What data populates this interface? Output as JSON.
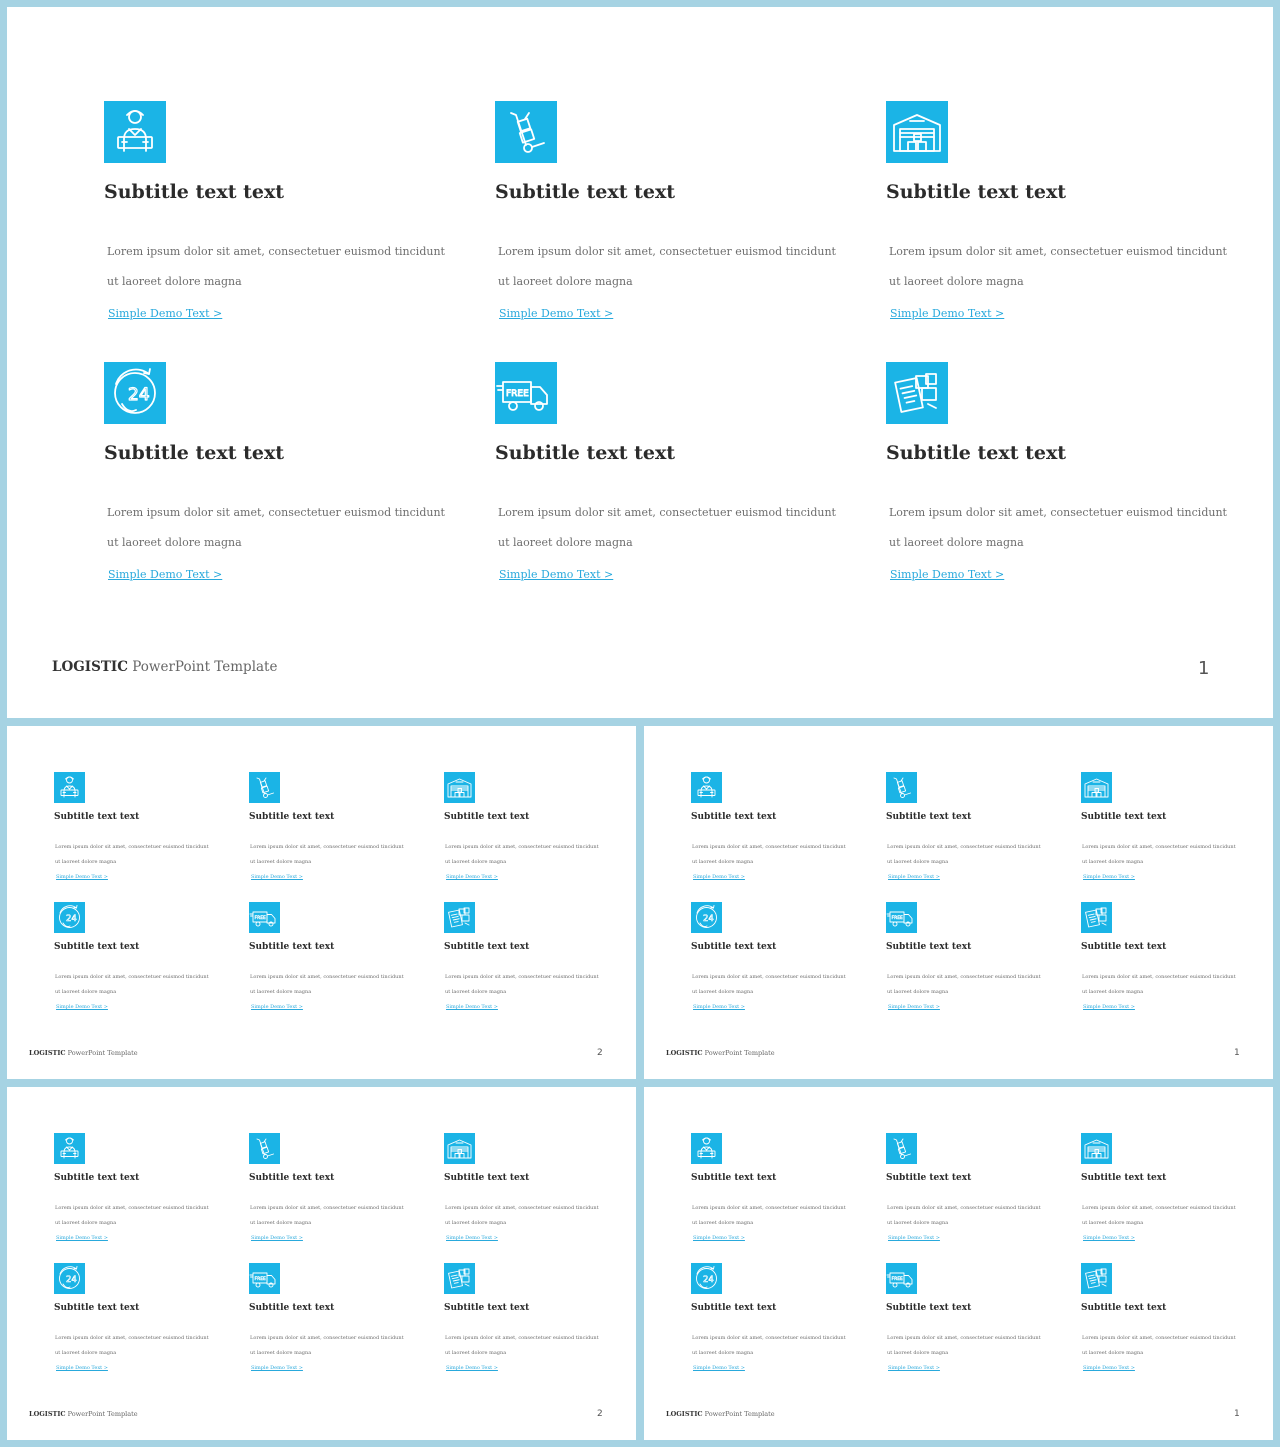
{
  "colors": {
    "accent": "#1bb4e6",
    "link": "#29a9dc",
    "frame": "#a6d3e3"
  },
  "cards": [
    {
      "icon": "delivery-man-icon",
      "subtitle": "Subtitle text text",
      "body_line1": "Lorem  ipsum  dolor  sit  amet,  consectetuer  euismod  tincidunt",
      "body_line2": "ut  laoreet  dolore  magna",
      "link": "Simple  Demo  Text  >"
    },
    {
      "icon": "hand-truck-icon",
      "subtitle": "Subtitle text text",
      "body_line1": "Lorem  ipsum  dolor  sit  amet,  consectetuer  euismod  tincidunt",
      "body_line2": "ut  laoreet  dolore  magna",
      "link": "Simple  Demo  Text  >"
    },
    {
      "icon": "warehouse-icon",
      "subtitle": "Subtitle text text",
      "body_line1": "Lorem  ipsum  dolor  sit  amet,  consectetuer  euismod  tincidunt",
      "body_line2": "ut  laoreet  dolore  magna",
      "link": "Simple  Demo  Text  >"
    },
    {
      "icon": "24-hour-service-icon",
      "subtitle": "Subtitle text text",
      "body_line1": "Lorem  ipsum  dolor  sit  amet,  consectetuer  euismod  tincidunt",
      "body_line2": "ut  laoreet  dolore  magna",
      "link": "Simple  Demo  Text  >"
    },
    {
      "icon": "free-delivery-truck-icon",
      "subtitle": "Subtitle text text",
      "body_line1": "Lorem  ipsum  dolor  sit  amet,  consectetuer  euismod  tincidunt",
      "body_line2": "ut  laoreet  dolore  magna",
      "link": "Simple  Demo  Text  >"
    },
    {
      "icon": "clipboard-boxes-icon",
      "subtitle": "Subtitle text text",
      "body_line1": "Lorem  ipsum  dolor  sit  amet,  consectetuer  euismod  tincidunt",
      "body_line2": "ut  laoreet  dolore  magna",
      "link": "Simple  Demo  Text  >"
    }
  ],
  "footer": {
    "brand": "LOGISTIC",
    "rest": " PowerPoint Template"
  },
  "slides": [
    {
      "page": "1"
    },
    {
      "page": "2"
    },
    {
      "page": "1"
    },
    {
      "page": "2"
    },
    {
      "page": "1"
    }
  ]
}
